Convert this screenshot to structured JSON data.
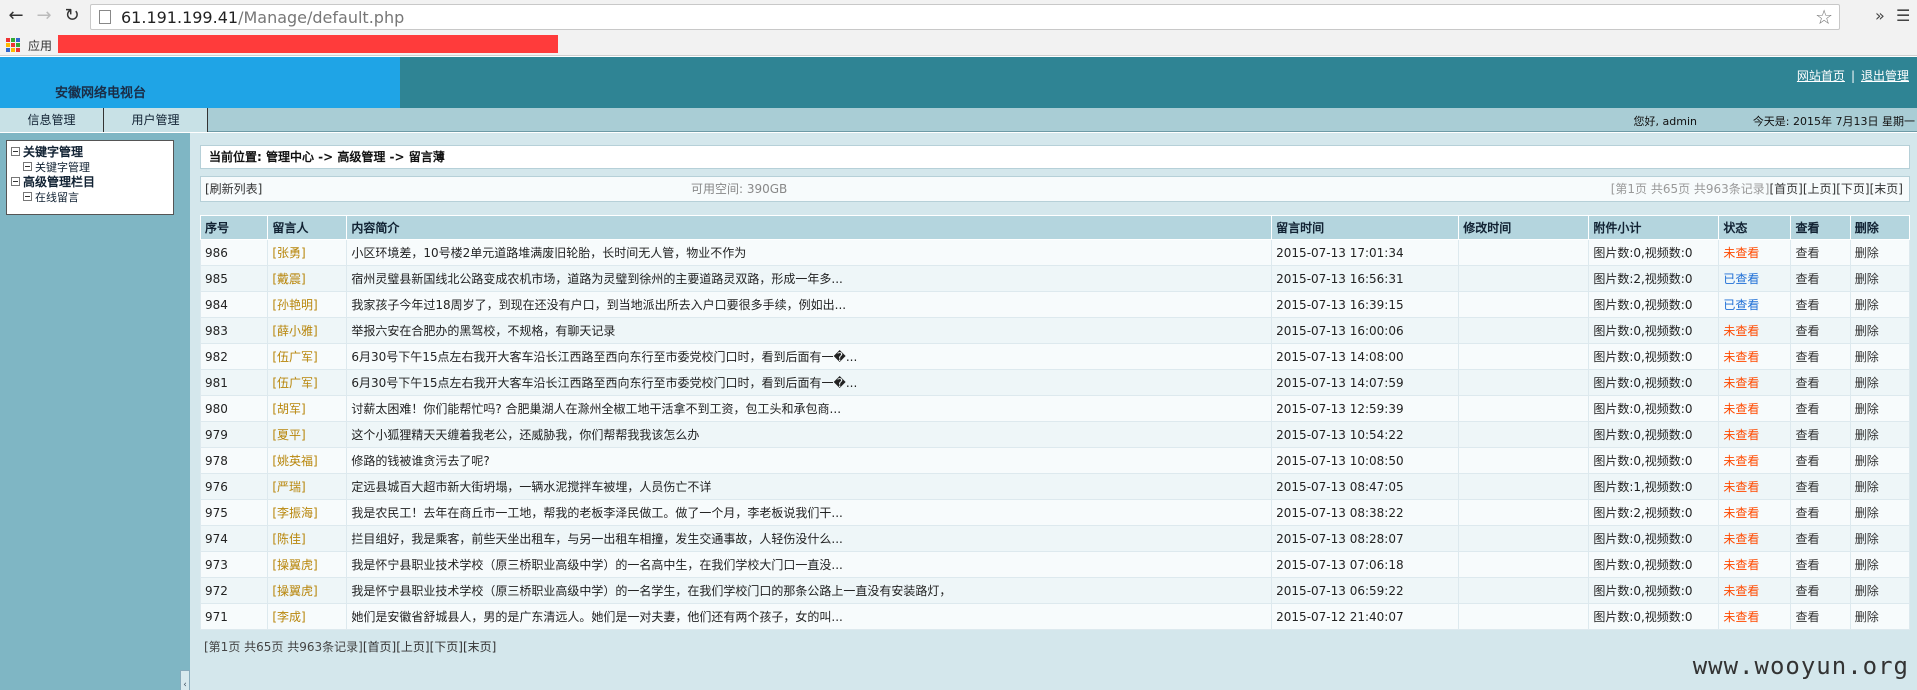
{
  "browser": {
    "url_host": "61.191.199.41",
    "url_path": "/Manage/default.php",
    "bookmarks_apps": "应用",
    "extensions_chevron": "»",
    "menu_icon": "☰",
    "colors": {
      "chrome_bg": "#f2f2f2",
      "redaction": "#ff3b3b"
    }
  },
  "header": {
    "site_name": "安徽网络电视台",
    "link_home": "网站首页",
    "link_logout": "退出管理",
    "separator": "|",
    "brand_color": "#1fa4e6",
    "bar_color": "#2f8494"
  },
  "menu": {
    "tab_info": "信息管理",
    "tab_user": "用户管理",
    "greeting": "您好, admin",
    "today": "今天是: 2015年 7月13日 星期一"
  },
  "sidebar": {
    "tree": [
      {
        "label": "关键字管理",
        "children": [
          "关键字管理"
        ]
      },
      {
        "label": "高级管理栏目",
        "children": [
          "在线留言"
        ]
      }
    ],
    "collapse_glyph": "‹"
  },
  "main": {
    "breadcrumb": "当前位置: 管理中心 -> 高级管理 -> 留言薄",
    "refresh": "[刷新列表]",
    "space": "可用空间: 390GB",
    "pager_info": "[第1页 共65页 共963条记录]",
    "pager_first": "[首页]",
    "pager_prev": "[上页]",
    "pager_next": "[下页]",
    "pager_last": "[末页]",
    "columns": [
      "序号",
      "留言人",
      "内容简介",
      "留言时间",
      "修改时间",
      "附件小计",
      "状态",
      "查看",
      "删除"
    ],
    "rows": [
      {
        "id": "986",
        "name": "[张勇]",
        "summary": "小区环境差，10号楼2单元道路堆满废旧轮胎，长时间无人管，物业不作为",
        "time": "2015-07-13 17:01:34",
        "modified": "",
        "attach": "图片数:0,视频数:0",
        "status": "未查看",
        "status_type": "unread",
        "view": "查看",
        "del": "删除"
      },
      {
        "id": "985",
        "name": "[戴震]",
        "summary": "宿州灵璧县新国线北公路变成农机市场，道路为灵璧到徐州的主要道路灵双路，形成一年多...",
        "time": "2015-07-13 16:56:31",
        "modified": "",
        "attach": "图片数:2,视频数:0",
        "status": "已查看",
        "status_type": "read",
        "view": "查看",
        "del": "删除"
      },
      {
        "id": "984",
        "name": "[孙艳明]",
        "summary": "我家孩子今年过18周岁了，到现在还没有户口，到当地派出所去入户口要很多手续，例如出...",
        "time": "2015-07-13 16:39:15",
        "modified": "",
        "attach": "图片数:0,视频数:0",
        "status": "已查看",
        "status_type": "read",
        "view": "查看",
        "del": "删除"
      },
      {
        "id": "983",
        "name": "[薛小雅]",
        "summary": "举报六安在合肥办的黑驾校，不规格，有聊天记录",
        "time": "2015-07-13 16:00:06",
        "modified": "",
        "attach": "图片数:0,视频数:0",
        "status": "未查看",
        "status_type": "unread",
        "view": "查看",
        "del": "删除"
      },
      {
        "id": "982",
        "name": "[伍广军]",
        "summary": "6月30号下午15点左右我开大客车沿长江西路至西向东行至市委党校门口时，看到后面有一�...",
        "time": "2015-07-13 14:08:00",
        "modified": "",
        "attach": "图片数:0,视频数:0",
        "status": "未查看",
        "status_type": "unread",
        "view": "查看",
        "del": "删除"
      },
      {
        "id": "981",
        "name": "[伍广军]",
        "summary": "6月30号下午15点左右我开大客车沿长江西路至西向东行至市委党校门口时，看到后面有一�...",
        "time": "2015-07-13 14:07:59",
        "modified": "",
        "attach": "图片数:0,视频数:0",
        "status": "未查看",
        "status_type": "unread",
        "view": "查看",
        "del": "删除"
      },
      {
        "id": "980",
        "name": "[胡军]",
        "summary": "讨薪太困难！你们能帮忙吗? 合肥巢湖人在滁州全椒工地干活拿不到工资，包工头和承包商...",
        "time": "2015-07-13 12:59:39",
        "modified": "",
        "attach": "图片数:0,视频数:0",
        "status": "未查看",
        "status_type": "unread",
        "view": "查看",
        "del": "删除"
      },
      {
        "id": "979",
        "name": "[夏平]",
        "summary": "这个小狐狸精天天缠着我老公，还威胁我，你们帮帮我我该怎么办",
        "time": "2015-07-13 10:54:22",
        "modified": "",
        "attach": "图片数:0,视频数:0",
        "status": "未查看",
        "status_type": "unread",
        "view": "查看",
        "del": "删除"
      },
      {
        "id": "978",
        "name": "[姚英福]",
        "summary": "修路的钱被谁贪污去了呢?",
        "time": "2015-07-13 10:08:50",
        "modified": "",
        "attach": "图片数:0,视频数:0",
        "status": "未查看",
        "status_type": "unread",
        "view": "查看",
        "del": "删除"
      },
      {
        "id": "976",
        "name": "[严瑞]",
        "summary": "定远县城百大超市新大街坍塌，一辆水泥搅拌车被埋，人员伤亡不详",
        "time": "2015-07-13 08:47:05",
        "modified": "",
        "attach": "图片数:1,视频数:0",
        "status": "未查看",
        "status_type": "unread",
        "view": "查看",
        "del": "删除"
      },
      {
        "id": "975",
        "name": "[李振海]",
        "summary": "我是农民工！去年在商丘市一工地，帮我的老板李泽民做工。做了一个月，李老板说我们干...",
        "time": "2015-07-13 08:38:22",
        "modified": "",
        "attach": "图片数:2,视频数:0",
        "status": "未查看",
        "status_type": "unread",
        "view": "查看",
        "del": "删除"
      },
      {
        "id": "974",
        "name": "[陈佳]",
        "summary": "拦目组好，我是乘客，前些天坐出租车，与另一出租车相撞，发生交通事故，人轻伤没什么...",
        "time": "2015-07-13 08:28:07",
        "modified": "",
        "attach": "图片数:0,视频数:0",
        "status": "未查看",
        "status_type": "unread",
        "view": "查看",
        "del": "删除"
      },
      {
        "id": "973",
        "name": "[操翼虎]",
        "summary": "我是怀宁县职业技术学校（原三桥职业高级中学）的一名高中生，在我们学校大门口一直没...",
        "time": "2015-07-13 07:06:18",
        "modified": "",
        "attach": "图片数:0,视频数:0",
        "status": "未查看",
        "status_type": "unread",
        "view": "查看",
        "del": "删除"
      },
      {
        "id": "972",
        "name": "[操翼虎]",
        "summary": "我是怀宁县职业技术学校（原三桥职业高级中学）的一名学生，在我们学校门口的那条公路上一直没有安装路灯，",
        "time": "2015-07-13 06:59:22",
        "modified": "",
        "attach": "图片数:0,视频数:0",
        "status": "未查看",
        "status_type": "unread",
        "view": "查看",
        "del": "删除"
      },
      {
        "id": "971",
        "name": "[李成]",
        "summary": "她们是安徽省舒城县人，男的是广东清远人。她们是一对夫妻，他们还有两个孩子，女的叫...",
        "time": "2015-07-12 21:40:07",
        "modified": "",
        "attach": "图片数:0,视频数:0",
        "status": "未查看",
        "status_type": "unread",
        "view": "查看",
        "del": "删除"
      }
    ],
    "bottom_info": "[第1页 共65页 共963条记录]",
    "bottom_first": "[首页]",
    "bottom_prev": "[上页]",
    "bottom_next": "[下页]",
    "bottom_last": "[末页]"
  },
  "watermark": "www.wooyun.org"
}
